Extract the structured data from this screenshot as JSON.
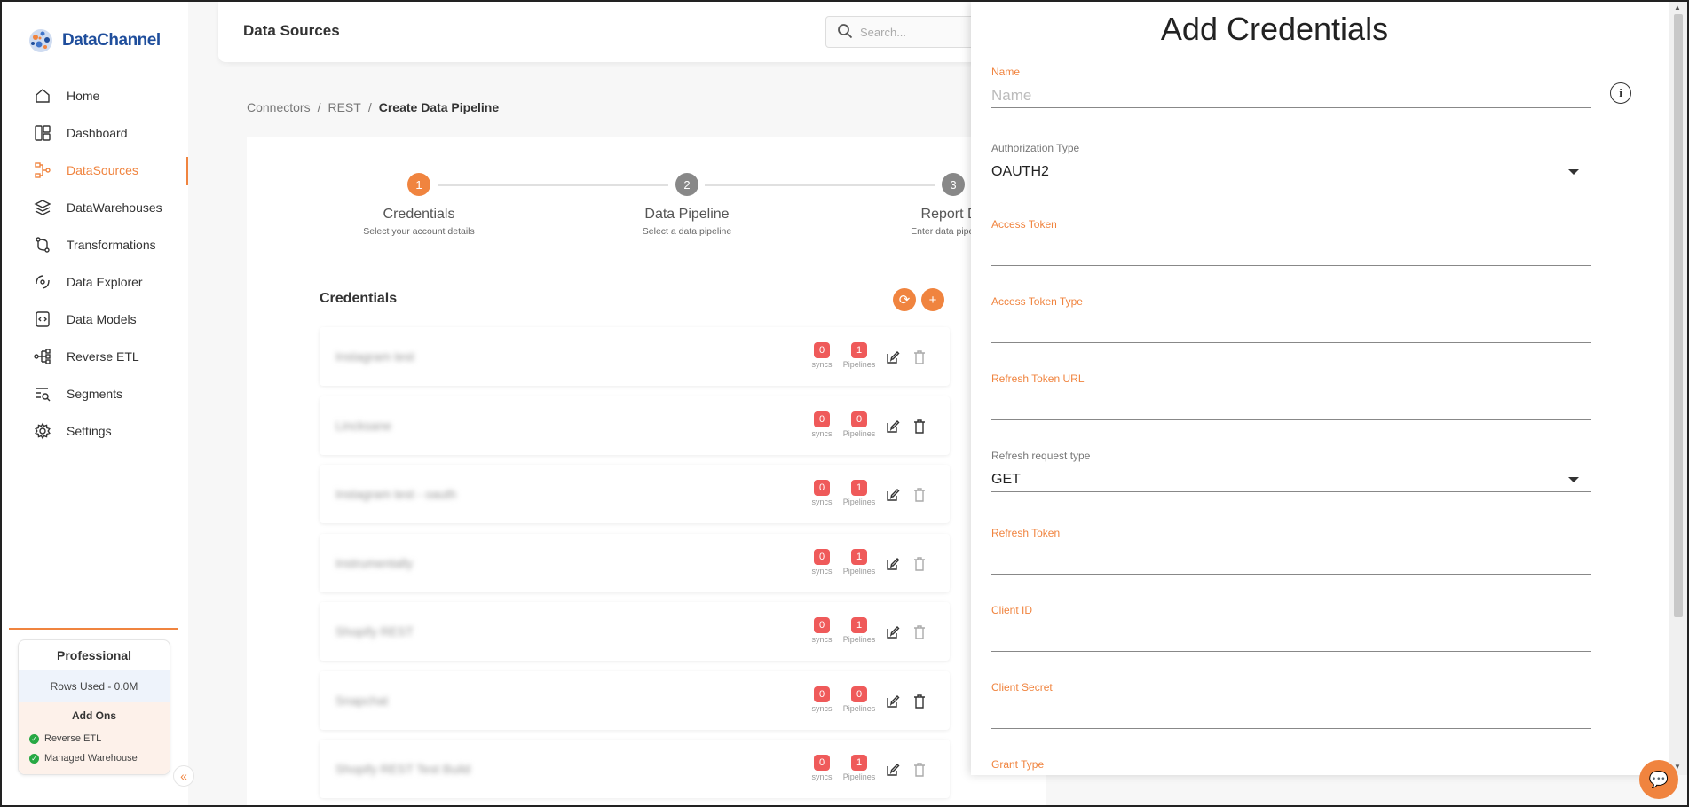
{
  "brand": {
    "name": "DataChannel"
  },
  "sidebar": {
    "items": [
      {
        "label": "Home",
        "icon": "home-icon"
      },
      {
        "label": "Dashboard",
        "icon": "dashboard-icon"
      },
      {
        "label": "DataSources",
        "icon": "datasources-icon",
        "active": true
      },
      {
        "label": "DataWarehouses",
        "icon": "datawarehouses-icon"
      },
      {
        "label": "Transformations",
        "icon": "transformations-icon"
      },
      {
        "label": "Data Explorer",
        "icon": "data-explorer-icon"
      },
      {
        "label": "Data Models",
        "icon": "data-models-icon"
      },
      {
        "label": "Reverse ETL",
        "icon": "reverse-etl-icon"
      },
      {
        "label": "Segments",
        "icon": "segments-icon"
      },
      {
        "label": "Settings",
        "icon": "settings-icon"
      }
    ],
    "plan": {
      "title": "Professional",
      "rows_used": "Rows Used - 0.0M",
      "addons_title": "Add Ons",
      "addons": [
        "Reverse ETL",
        "Managed Warehouse"
      ]
    }
  },
  "header": {
    "title": "Data Sources",
    "search_placeholder": "Search..."
  },
  "breadcrumb": [
    "Connectors",
    "REST",
    "Create Data Pipeline"
  ],
  "stepper": [
    {
      "num": "1",
      "title": "Credentials",
      "subtitle": "Select your account details",
      "active": true
    },
    {
      "num": "2",
      "title": "Data Pipeline",
      "subtitle": "Select a data pipeline",
      "active": false
    },
    {
      "num": "3",
      "title": "Report De",
      "subtitle": "Enter data pipeline c",
      "active": false
    }
  ],
  "credentials": {
    "title": "Credentials",
    "sync_label": "syncs",
    "pipelines_label": "Pipelines",
    "rows": [
      {
        "name": "Instagram test",
        "syncs": "0",
        "pipelines": "1"
      },
      {
        "name": "Lincksane",
        "syncs": "0",
        "pipelines": "0"
      },
      {
        "name": "Instagram test - oauth",
        "syncs": "0",
        "pipelines": "1"
      },
      {
        "name": "Instrumentally",
        "syncs": "0",
        "pipelines": "1"
      },
      {
        "name": "Shopify REST",
        "syncs": "0",
        "pipelines": "1"
      },
      {
        "name": "Snapchat",
        "syncs": "0",
        "pipelines": "0"
      },
      {
        "name": "Shopify REST Test Build",
        "syncs": "0",
        "pipelines": "1"
      }
    ]
  },
  "drawer": {
    "title": "Add Credentials",
    "name_label": "Name",
    "name_placeholder": "Name",
    "auth_type_label": "Authorization Type",
    "auth_type_value": "OAUTH2",
    "access_token_label": "Access Token",
    "access_token_type_label": "Access Token Type",
    "refresh_token_url_label": "Refresh Token URL",
    "refresh_request_type_label": "Refresh request type",
    "refresh_request_type_value": "GET",
    "refresh_token_label": "Refresh Token",
    "client_id_label": "Client ID",
    "client_secret_label": "Client Secret",
    "grant_type_label": "Grant Type"
  },
  "colors": {
    "accent": "#f0843f",
    "badge": "#ef5a5a",
    "step_inactive": "#888888"
  }
}
